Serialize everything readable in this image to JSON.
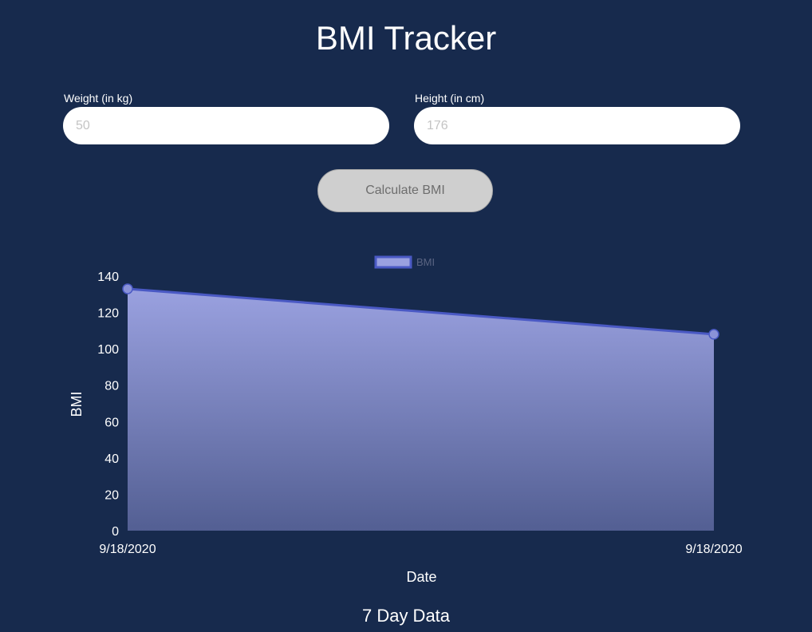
{
  "header": {
    "title": "BMI Tracker"
  },
  "form": {
    "weight": {
      "label": "Weight (in kg)",
      "placeholder": "50",
      "value": ""
    },
    "height": {
      "label": "Height (in cm)",
      "placeholder": "176",
      "value": ""
    },
    "calculate_label": "Calculate BMI"
  },
  "colors": {
    "background": "#172a4d",
    "series_line": "#4a59c4",
    "series_fill_top": "#9aa1e0",
    "series_fill_bottom": "#535f93",
    "point_fill": "#8a92d8",
    "legend_text": "#5a6482"
  },
  "chart_data": {
    "type": "area",
    "x": [
      "9/18/2020",
      "9/18/2020"
    ],
    "series": [
      {
        "name": "BMI",
        "values": [
          133,
          108
        ]
      }
    ],
    "xlabel": "Date",
    "ylabel": "BMI",
    "ylim": [
      0,
      140
    ],
    "yticks": [
      "0",
      "20",
      "40",
      "60",
      "80",
      "100",
      "120",
      "140"
    ],
    "legend": "top-center",
    "grid": false
  },
  "footer": {
    "title": "7 Day Data"
  }
}
